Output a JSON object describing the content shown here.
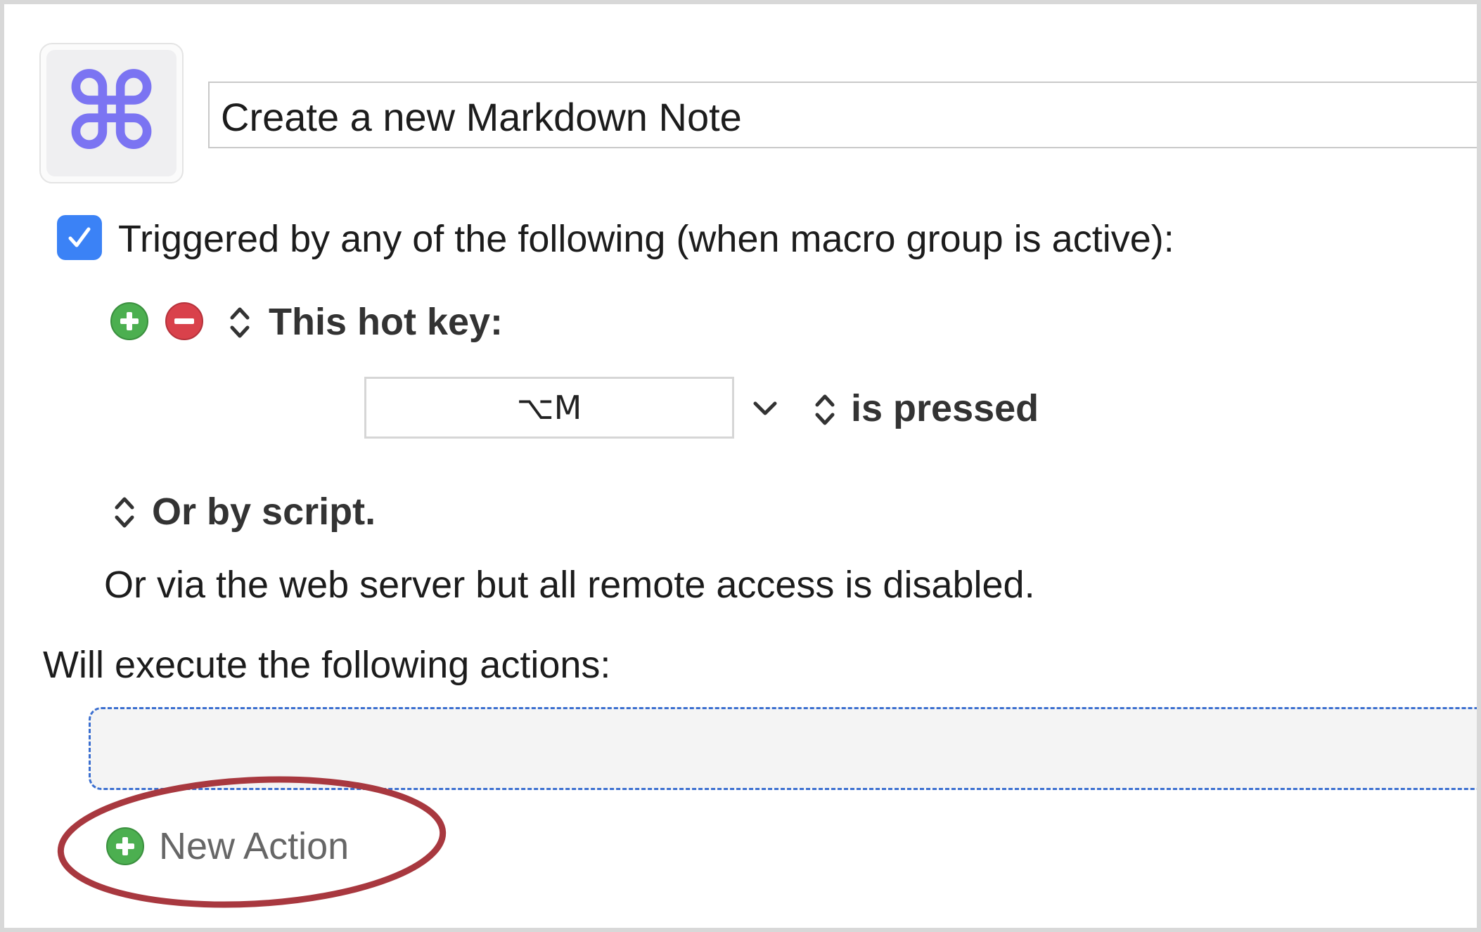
{
  "macro": {
    "icon_name": "command-key-icon",
    "icon_glyph": "⌘",
    "title": "Create a new Markdown Note"
  },
  "trigger": {
    "enabled": true,
    "label": "Triggered by any of the following (when macro group is active):",
    "add_icon": "plus-circle-icon",
    "remove_icon": "minus-circle-icon",
    "type_label": "This hot key:",
    "hotkey_value": "⌥M",
    "condition_label": "is pressed",
    "script_label": "Or by script.",
    "web_server_note": "Or via the web server but all remote access is disabled."
  },
  "actions": {
    "heading": "Will execute the following actions:",
    "new_action_label": "New Action"
  },
  "colors": {
    "accent_blue": "#3b82f6",
    "add_green": "#4caf50",
    "remove_red": "#d9414b",
    "highlight_ring": "#a8383f",
    "command_icon": "#7b74f2"
  }
}
